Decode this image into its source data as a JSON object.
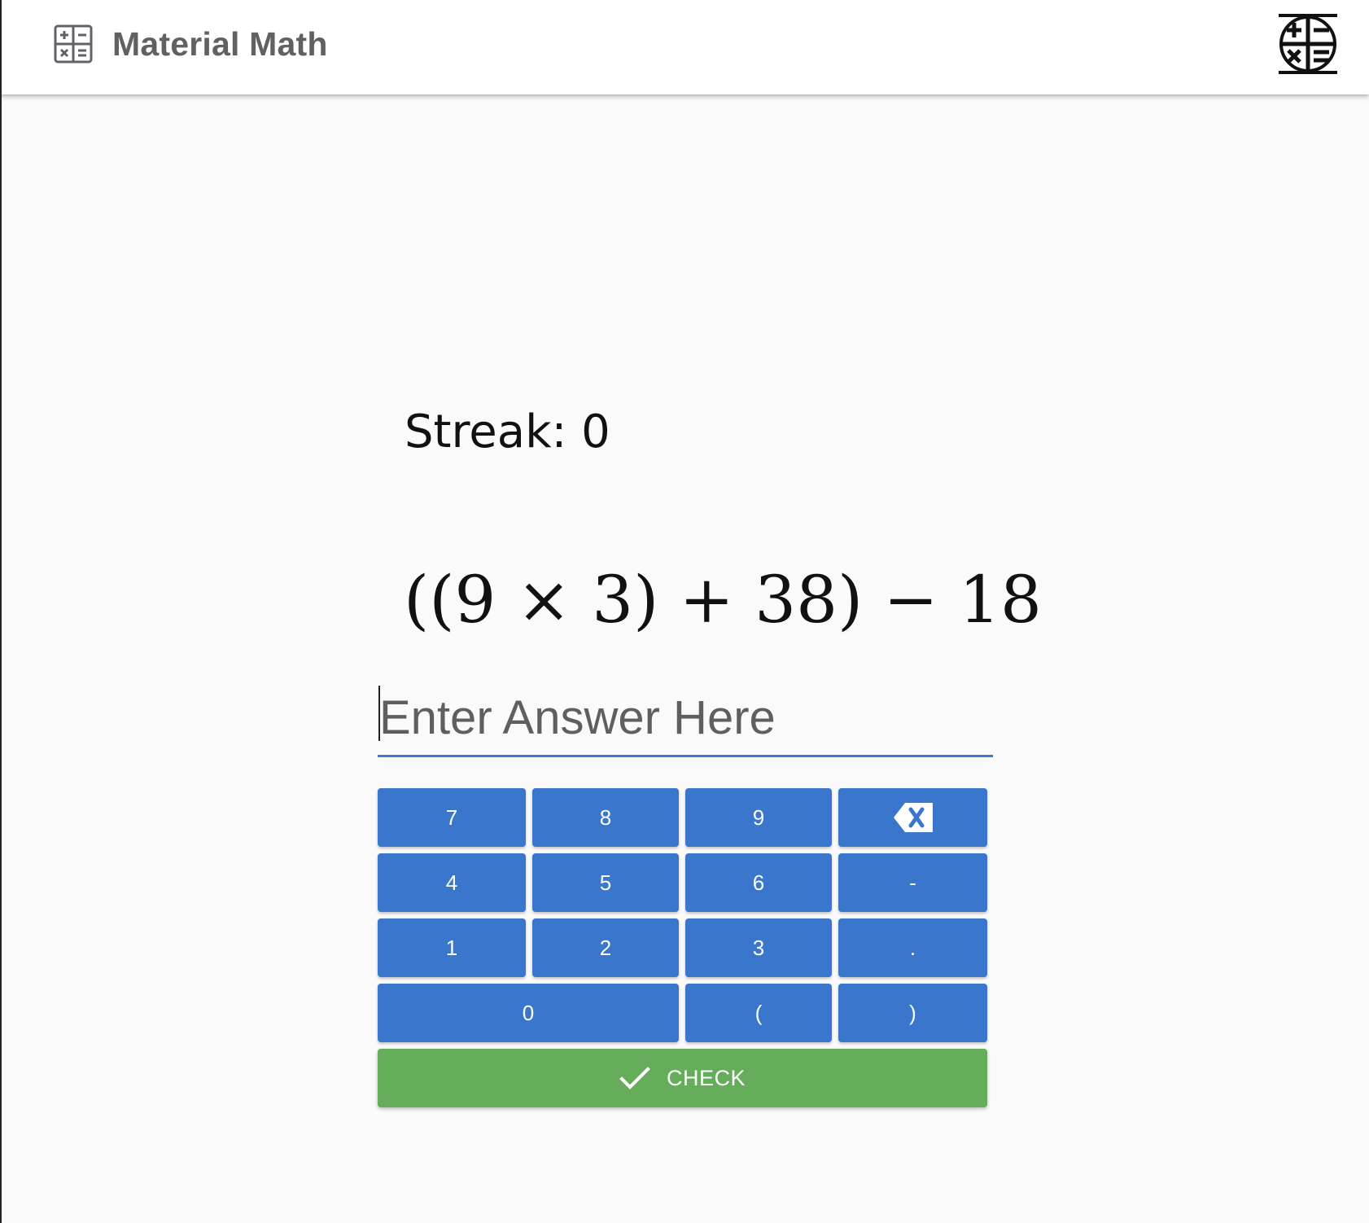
{
  "app": {
    "title": "Material Math",
    "app_icon": "calculator-operations-icon",
    "logo_icon": "math-operations-logo-icon"
  },
  "game": {
    "streak_label": "Streak: 0",
    "expression": "((9 × 3) + 38) − 18"
  },
  "answer": {
    "placeholder": "Enter Answer Here",
    "value": ""
  },
  "keypad": {
    "row1": [
      "7",
      "8",
      "9"
    ],
    "row2": [
      "4",
      "5",
      "6",
      "-"
    ],
    "row3": [
      "1",
      "2",
      "3",
      "."
    ],
    "row4": [
      "0",
      "(",
      ")"
    ],
    "backspace_icon": "backspace-icon",
    "check_label": "CHECK",
    "check_icon": "checkmark-icon"
  },
  "colors": {
    "key_blue": "#3a77cc",
    "check_green": "#66ad5b",
    "title_gray": "#616161",
    "underline_blue": "#3f78cc"
  }
}
